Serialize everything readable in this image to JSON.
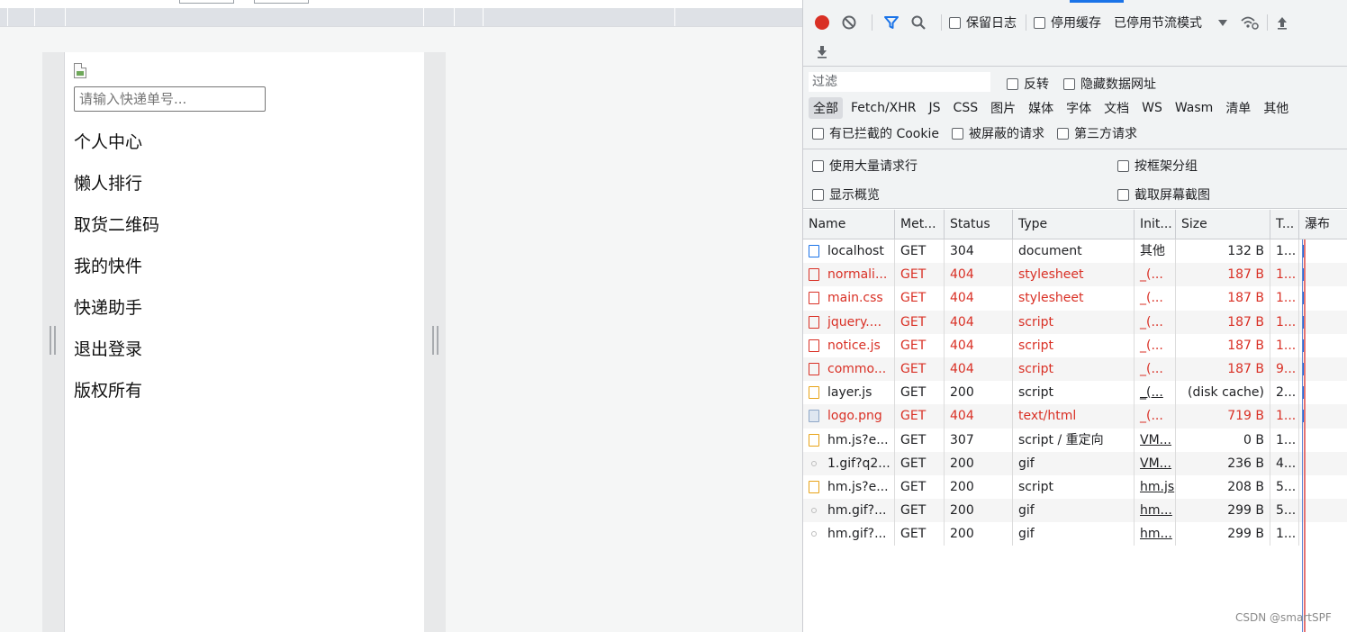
{
  "viewport": {
    "search_placeholder": "请输入快递单号...",
    "menu": [
      "个人中心",
      "懒人排行",
      "取货二维码",
      "我的快件",
      "快递助手",
      "退出登录",
      "版权所有"
    ]
  },
  "devtools": {
    "toolbar": {
      "preserve_log": "保留日志",
      "disable_cache": "停用缓存",
      "throttling": "已停用节流模式"
    },
    "filter": {
      "placeholder": "过滤",
      "invert": "反转",
      "hide_data_urls": "隐藏数据网址",
      "types": [
        "全部",
        "Fetch/XHR",
        "JS",
        "CSS",
        "图片",
        "媒体",
        "字体",
        "文档",
        "WS",
        "Wasm",
        "清单",
        "其他"
      ],
      "blocked_cookies": "有已拦截的 Cookie",
      "blocked_requests": "被屏蔽的请求",
      "third_party": "第三方请求"
    },
    "settings": {
      "large_rows": "使用大量请求行",
      "group_by_frame": "按框架分组",
      "show_overview": "显示概览",
      "capture_screenshots": "截取屏幕截图"
    },
    "columns": [
      "Name",
      "Met...",
      "Status",
      "Type",
      "Init...",
      "Size",
      "T...",
      "瀑布"
    ],
    "requests": [
      {
        "name": "localhost",
        "method": "GET",
        "status": "304",
        "type": "document",
        "initiator": "其他",
        "size": "132 B",
        "time": "1...",
        "icon": "doc",
        "error": false
      },
      {
        "name": "normali...",
        "method": "GET",
        "status": "404",
        "type": "stylesheet",
        "initiator": "_(...",
        "size": "187 B",
        "time": "1...",
        "icon": "css",
        "error": true
      },
      {
        "name": "main.css",
        "method": "GET",
        "status": "404",
        "type": "stylesheet",
        "initiator": "_(...",
        "size": "187 B",
        "time": "1...",
        "icon": "css",
        "error": true
      },
      {
        "name": "jquery....",
        "method": "GET",
        "status": "404",
        "type": "script",
        "initiator": "_(...",
        "size": "187 B",
        "time": "1...",
        "icon": "js",
        "error": true
      },
      {
        "name": "notice.js",
        "method": "GET",
        "status": "404",
        "type": "script",
        "initiator": "_(...",
        "size": "187 B",
        "time": "1...",
        "icon": "js",
        "error": true
      },
      {
        "name": "commo...",
        "method": "GET",
        "status": "404",
        "type": "script",
        "initiator": "_(...",
        "size": "187 B",
        "time": "9...",
        "icon": "js",
        "error": true
      },
      {
        "name": "layer.js",
        "method": "GET",
        "status": "200",
        "type": "script",
        "initiator": "_(...",
        "size": "(disk cache)",
        "time": "2...",
        "icon": "js-ok",
        "error": false
      },
      {
        "name": "logo.png",
        "method": "GET",
        "status": "404",
        "type": "text/html",
        "initiator": "_(...",
        "size": "719 B",
        "time": "1...",
        "icon": "img",
        "error": true
      },
      {
        "name": "hm.js?e...",
        "method": "GET",
        "status": "307",
        "type": "script / 重定向",
        "initiator": "VM...",
        "size": "0 B",
        "time": "1...",
        "icon": "js-ok",
        "error": false
      },
      {
        "name": "1.gif?q2...",
        "method": "GET",
        "status": "200",
        "type": "gif",
        "initiator": "VM...",
        "size": "236 B",
        "time": "4...",
        "icon": "dot",
        "error": false
      },
      {
        "name": "hm.js?e...",
        "method": "GET",
        "status": "200",
        "type": "script",
        "initiator": "hm.js",
        "size": "208 B",
        "time": "5...",
        "icon": "js-ok",
        "error": false
      },
      {
        "name": "hm.gif?...",
        "method": "GET",
        "status": "200",
        "type": "gif",
        "initiator": "hm...",
        "size": "299 B",
        "time": "5...",
        "icon": "dot",
        "error": false
      },
      {
        "name": "hm.gif?...",
        "method": "GET",
        "status": "200",
        "type": "gif",
        "initiator": "hm...",
        "size": "299 B",
        "time": "1...",
        "icon": "dot",
        "error": false
      }
    ]
  },
  "watermark": "CSDN @smartSPF"
}
